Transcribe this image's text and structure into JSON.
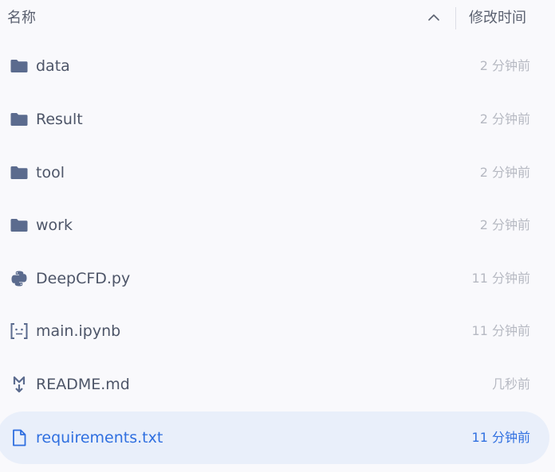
{
  "header": {
    "name_label": "名称",
    "modified_label": "修改时间",
    "sort_icon": "chevron-up-icon"
  },
  "colors": {
    "folder": "#5b6b8e",
    "selected_text": "#2f6fe0",
    "selected_bg": "#e9effa",
    "time_text": "#b6b9c2"
  },
  "files": [
    {
      "name": "data",
      "time": "2 分钟前",
      "icon": "folder-icon",
      "selected": false
    },
    {
      "name": "Result",
      "time": "2 分钟前",
      "icon": "folder-icon",
      "selected": false
    },
    {
      "name": "tool",
      "time": "2 分钟前",
      "icon": "folder-icon",
      "selected": false
    },
    {
      "name": "work",
      "time": "2 分钟前",
      "icon": "folder-icon",
      "selected": false
    },
    {
      "name": "DeepCFD.py",
      "time": "11 分钟前",
      "icon": "python-file-icon",
      "selected": false
    },
    {
      "name": "main.ipynb",
      "time": "11 分钟前",
      "icon": "notebook-file-icon",
      "selected": false
    },
    {
      "name": "README.md",
      "time": "几秒前",
      "icon": "markdown-file-icon",
      "selected": false
    },
    {
      "name": "requirements.txt",
      "time": "11 分钟前",
      "icon": "text-file-icon",
      "selected": true
    }
  ]
}
